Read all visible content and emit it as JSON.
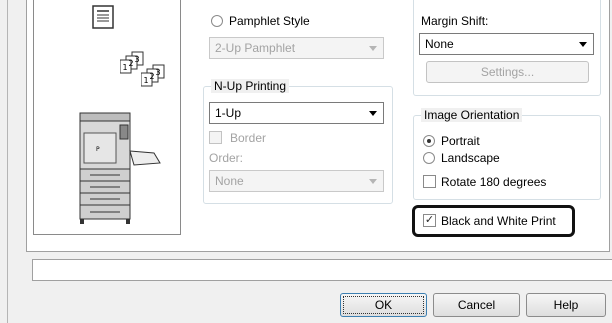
{
  "booklet": {
    "pamphlet_style_label": "Pamphlet Style",
    "pamphlet_select_value": "2-Up Pamphlet"
  },
  "nup": {
    "title": "N-Up Printing",
    "value": "1-Up",
    "border_label": "Border",
    "order_label": "Order:",
    "order_value": "None"
  },
  "margin": {
    "label": "Margin Shift:",
    "value": "None",
    "settings_label": "Settings..."
  },
  "orientation": {
    "title": "Image Orientation",
    "portrait_label": "Portrait",
    "landscape_label": "Landscape",
    "rotate_label": "Rotate 180 degrees"
  },
  "bw": {
    "label": "Black and White Print",
    "checked": true
  },
  "buttons": {
    "ok": "OK",
    "cancel": "Cancel",
    "help": "Help"
  },
  "colors": {
    "highlight_border": "#111111",
    "window_bg": "#f0f0f0"
  }
}
